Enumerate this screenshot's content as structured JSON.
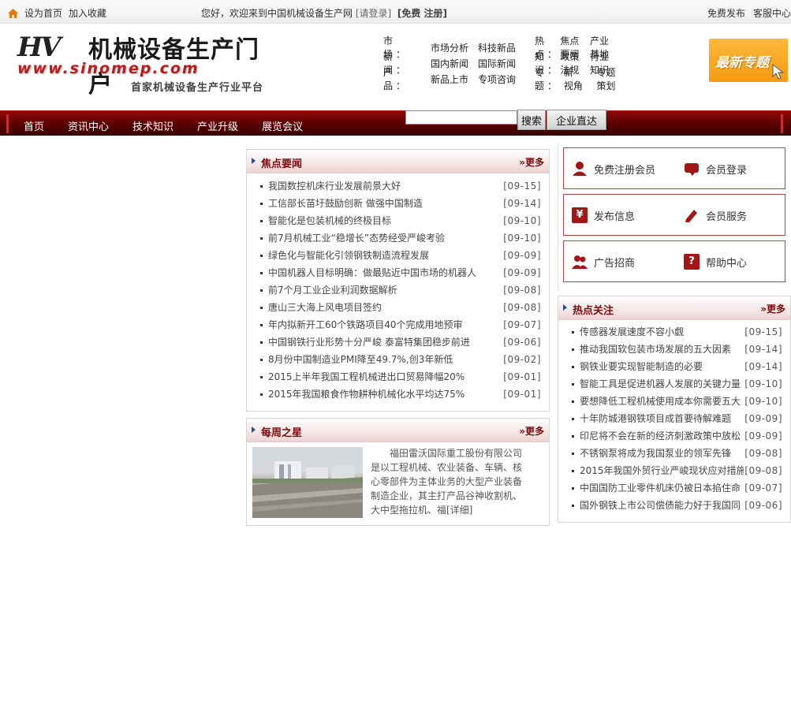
{
  "topbar": {
    "set_home": "设为首页",
    "add_fav": "加入收藏",
    "welcome": "您好，欢迎来到中国机械设备生产网",
    "login": "[请登录]",
    "register": "[免费 注册]",
    "free_post": "免费发布",
    "service_center": "客服中心"
  },
  "logo": {
    "mark": "HV",
    "name": "机械设备生产门户",
    "url": "www.sinomep.com",
    "slogan": "首家机械设备生产行业平台"
  },
  "header_nav": {
    "rows": [
      {
        "label": "市　场：",
        "links": [
          "市场分析",
          "科技新品"
        ],
        "label2": "热　点：",
        "links2": [
          "焦点要闻",
          "产业基地"
        ]
      },
      {
        "label": "新　闻：",
        "links": [
          "国内新闻",
          "国际新闻"
        ],
        "label2": "知　识：",
        "links2": [
          "政策法规",
          "行业知识"
        ]
      },
      {
        "label": "产　品：",
        "links": [
          "新品上市",
          "专项咨询"
        ],
        "label2": "专　题：",
        "links2": [
          "新　视角",
          "专题策划"
        ]
      }
    ]
  },
  "promo": {
    "label": "最新专题"
  },
  "navbar": {
    "items": [
      "首页",
      "资讯中心",
      "技术知识",
      "产业升级",
      "展览会议"
    ],
    "search_button": "搜索",
    "corp_button": "企业直达",
    "search_value": ""
  },
  "focus_news": {
    "title": "焦点要闻",
    "more": "»更多",
    "items": [
      {
        "title": "我国数控机床行业发展前景大好",
        "date": "[09-15]"
      },
      {
        "title": "工信部长苗圩鼓励创新 做强中国制造",
        "date": "[09-14]"
      },
      {
        "title": "智能化是包装机械的终极目标",
        "date": "[09-10]"
      },
      {
        "title": "前7月机械工业“稳增长”态势经受严峻考验",
        "date": "[09-10]"
      },
      {
        "title": "绿色化与智能化引领钢铁制造流程发展",
        "date": "[09-09]"
      },
      {
        "title": "中国机器人目标明确：做最贴近中国市场的机器人",
        "date": "[09-09]"
      },
      {
        "title": "前7个月工业企业利润数据解析",
        "date": "[09-08]"
      },
      {
        "title": "唐山三大海上风电项目签约",
        "date": "[09-08]"
      },
      {
        "title": "年内拟新开工60个铁路项目40个完成用地预审",
        "date": "[09-07]"
      },
      {
        "title": "中国钢铁行业形势十分严峻 泰富特集团稳步前进",
        "date": "[09-06]"
      },
      {
        "title": "8月份中国制造业PMI降至49.7%,创3年新低",
        "date": "[09-02]"
      },
      {
        "title": "2015上半年我国工程机械进出口贸易降幅20%",
        "date": "[09-01]"
      },
      {
        "title": "2015年我国粮食作物耕种机械化水平均达75%",
        "date": "[09-01]"
      }
    ]
  },
  "weekly_star": {
    "title": "每周之星",
    "more": "»更多",
    "text": "福田雷沃国际重工股份有限公司是以工程机械、农业装备、车辆、核心零部件为主体业务的大型产业装备制造企业，其主打产品谷神收割机、大中型拖拉机、福[详细]"
  },
  "services": [
    {
      "left": "免费注册会员",
      "right": "会员登录"
    },
    {
      "left": "发布信息",
      "right": "会员服务"
    },
    {
      "left": "广告招商",
      "right": "帮助中心"
    }
  ],
  "hot_news": {
    "title": "热点关注",
    "more": "»更多",
    "items": [
      {
        "title": "传感器发展速度不容小觑",
        "date": "[09-15]"
      },
      {
        "title": "推动我国软包装市场发展的五大因素",
        "date": "[09-14]"
      },
      {
        "title": "钢铁业要实现智能制造的必要",
        "date": "[09-14]"
      },
      {
        "title": "智能工具是促进机器人发展的关键力量",
        "date": "[09-10]"
      },
      {
        "title": "要想降低工程机械使用成本你需要五大",
        "date": "[09-10]"
      },
      {
        "title": "十年防城港钢铁项目成首要待解难题",
        "date": "[09-09]"
      },
      {
        "title": "印尼将不会在新的经济刺激政策中放松",
        "date": "[09-09]"
      },
      {
        "title": "不锈钢泵将成为我国泵业的领军先锋",
        "date": "[09-08]"
      },
      {
        "title": "2015年我国外贸行业严峻现状应对措施",
        "date": "[09-08]"
      },
      {
        "title": "中国国防工业零件机床仍被日本掐住命",
        "date": "[09-07]"
      },
      {
        "title": "国外钢铁上市公司偿债能力好于我国同",
        "date": "[09-06]"
      }
    ]
  }
}
